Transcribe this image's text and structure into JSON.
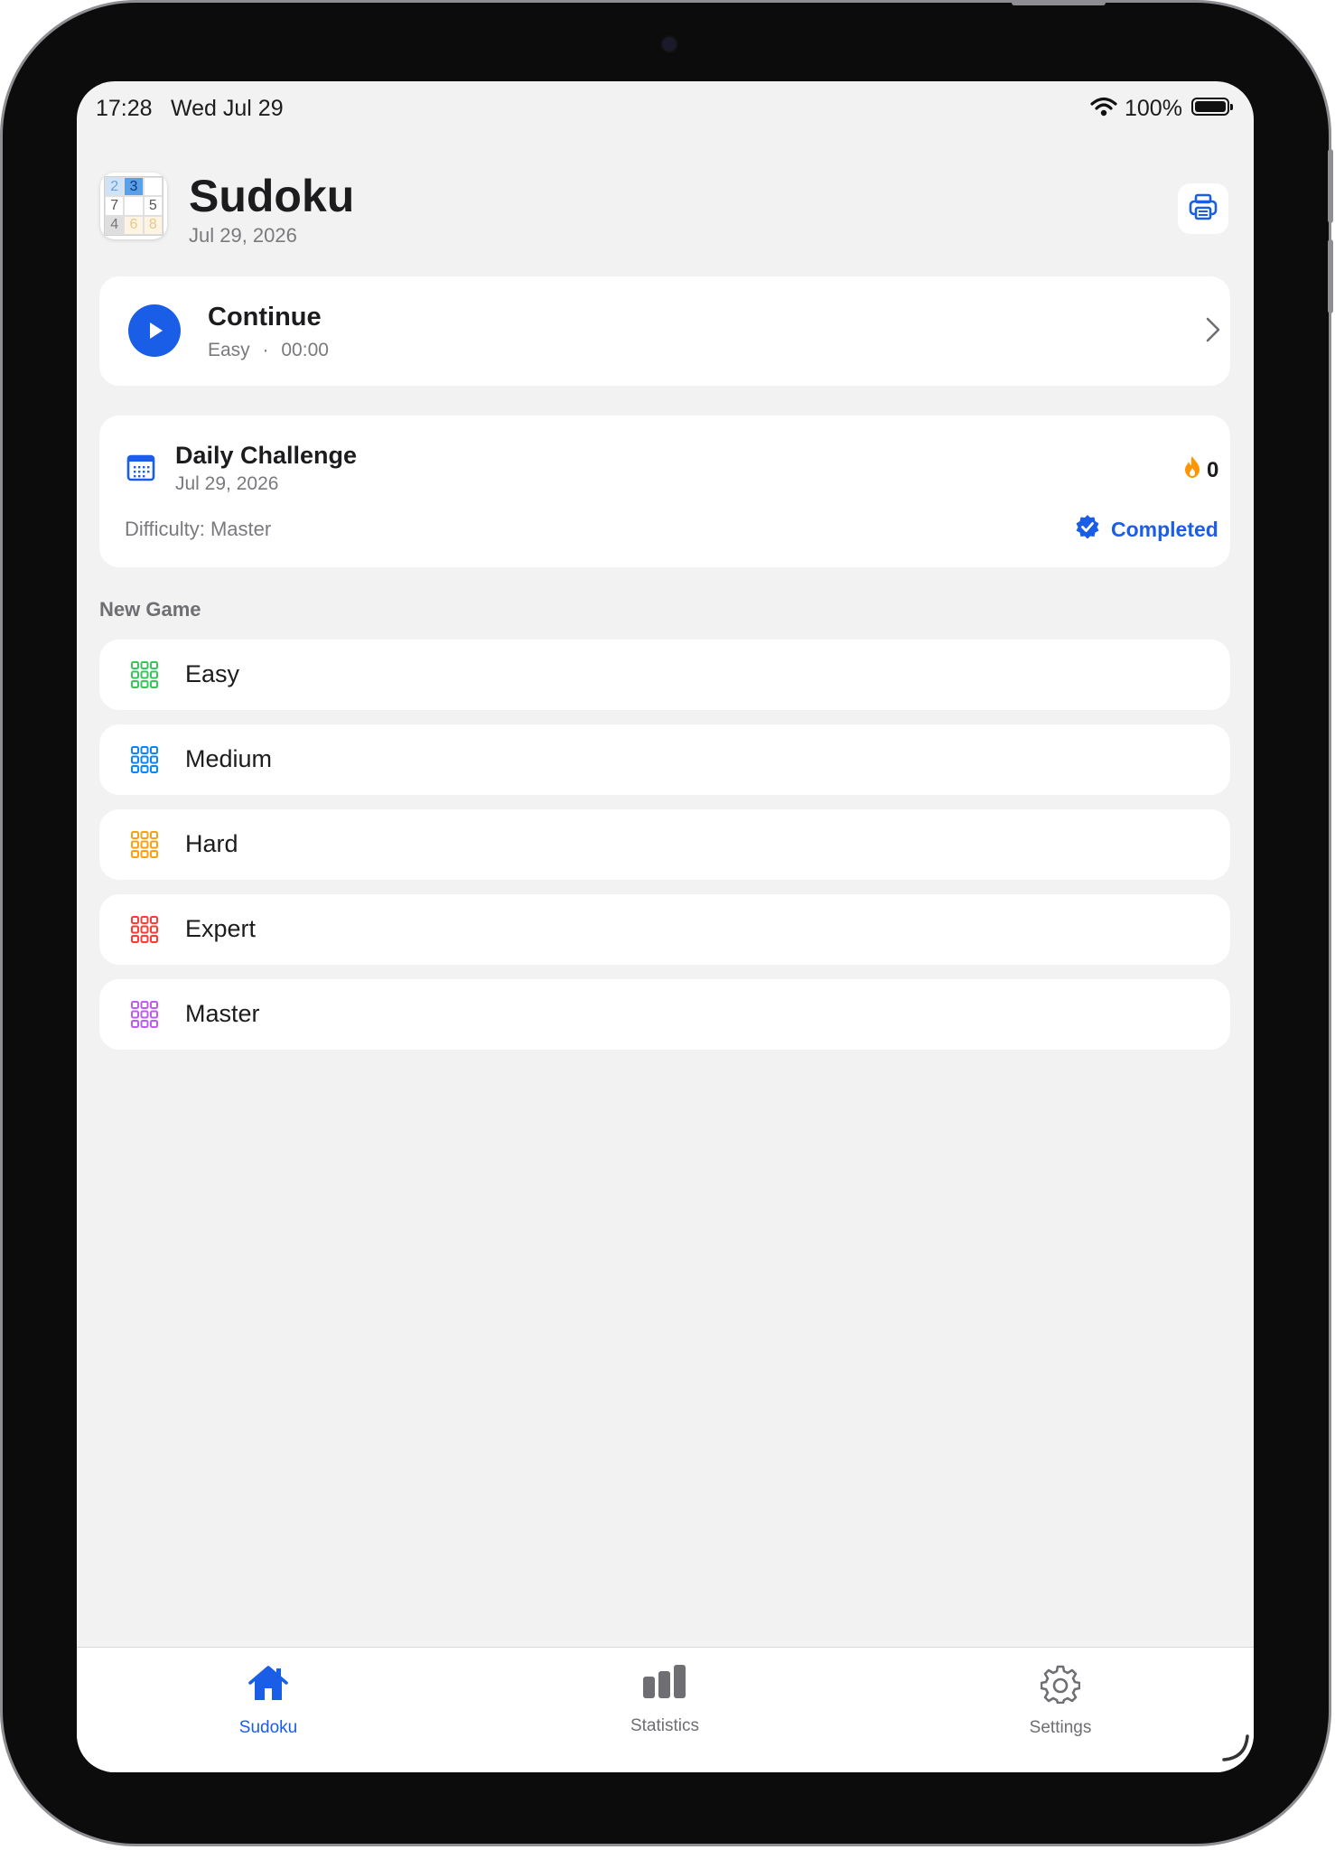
{
  "status_bar": {
    "time": "17:28",
    "date": "Wed Jul 29",
    "battery": "100%"
  },
  "header": {
    "title": "Sudoku",
    "subtitle": "Jul 29, 2026",
    "app_icon_digits": [
      "2",
      "3",
      "",
      "7",
      "",
      "5",
      "4",
      "6",
      "8"
    ]
  },
  "continue_card": {
    "title": "Continue",
    "difficulty": "Easy",
    "separator": "·",
    "time": "00:00"
  },
  "daily_challenge": {
    "title": "Daily Challenge",
    "date": "Jul 29, 2026",
    "streak": "0",
    "difficulty": "Difficulty: Master",
    "status": "Completed"
  },
  "new_game": {
    "section_label": "New Game",
    "modes": [
      {
        "label": "Easy",
        "color": "#34c759"
      },
      {
        "label": "Medium",
        "color": "#0a84ff"
      },
      {
        "label": "Hard",
        "color": "#ff9f0a"
      },
      {
        "label": "Expert",
        "color": "#ff3b30"
      },
      {
        "label": "Master",
        "color": "#bf5af2"
      }
    ]
  },
  "tabbar": {
    "tabs": [
      {
        "label": "Sudoku",
        "icon": "house-icon",
        "active": true
      },
      {
        "label": "Statistics",
        "icon": "bar-chart-icon",
        "active": false
      },
      {
        "label": "Settings",
        "icon": "gear-icon",
        "active": false
      }
    ]
  },
  "colors": {
    "accent": "#1a5de6",
    "background": "#f2f2f2",
    "streak_flame": "#ff9500"
  }
}
